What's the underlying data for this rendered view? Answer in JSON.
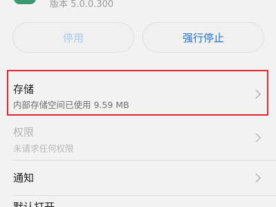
{
  "header": {
    "version_text": "版本 5.0.0.300"
  },
  "actions": {
    "disable_label": "停用",
    "force_stop_label": "强行停止"
  },
  "storage": {
    "title": "存储",
    "subtitle": "内部存储空间已使用 9.59 MB"
  },
  "permissions": {
    "title": "权限",
    "subtitle": "未请求任何权限"
  },
  "notifications": {
    "title": "通知"
  },
  "next_item": {
    "title": "默认打开"
  },
  "colors": {
    "accent_blue": "#1e6fc9",
    "highlight_red": "#e0242e",
    "disabled_blue": "#a8c8ea"
  }
}
